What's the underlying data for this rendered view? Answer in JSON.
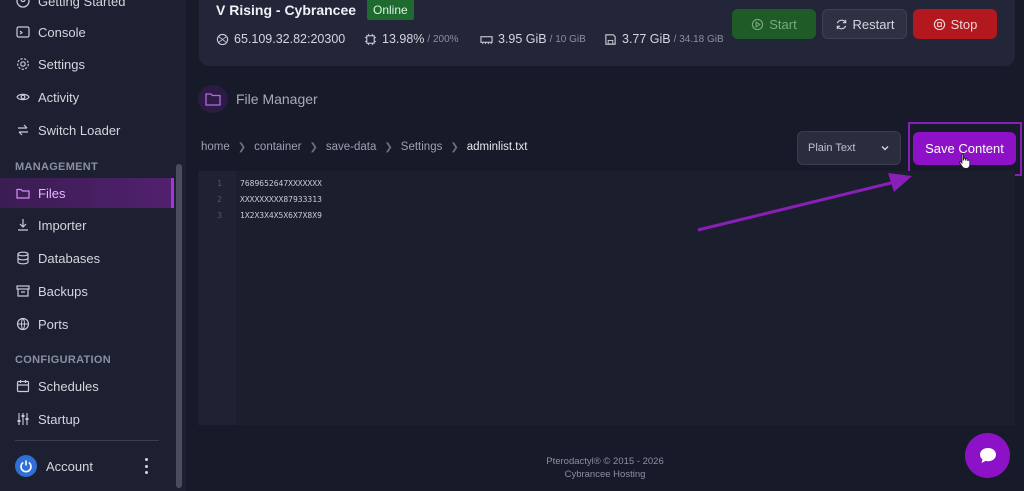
{
  "sidebar": {
    "items": [
      {
        "label": "Getting Started",
        "icon": "user-circle-icon"
      },
      {
        "label": "Console",
        "icon": "terminal-icon"
      },
      {
        "label": "Settings",
        "icon": "gear-icon"
      },
      {
        "label": "Activity",
        "icon": "eye-icon"
      },
      {
        "label": "Switch Loader",
        "icon": "swap-icon"
      }
    ],
    "management_heading": "MANAGEMENT",
    "management": [
      {
        "label": "Files",
        "icon": "folder-icon",
        "active": true
      },
      {
        "label": "Importer",
        "icon": "download-icon"
      },
      {
        "label": "Databases",
        "icon": "database-icon"
      },
      {
        "label": "Backups",
        "icon": "archive-icon"
      },
      {
        "label": "Ports",
        "icon": "globe-icon"
      }
    ],
    "configuration_heading": "CONFIGURATION",
    "configuration": [
      {
        "label": "Schedules",
        "icon": "calendar-icon"
      },
      {
        "label": "Startup",
        "icon": "sliders-icon"
      }
    ],
    "account_label": "Account"
  },
  "server": {
    "name": "V Rising - Cybrancee",
    "status": "Online",
    "address": "65.109.32.82:20300",
    "cpu": "13.98%",
    "cpu_limit": "/ 200%",
    "memory": "3.95 GiB",
    "memory_limit": "/ 10 GiB",
    "disk": "3.77 GiB",
    "disk_limit": "/ 34.18 GiB",
    "start_label": "Start",
    "restart_label": "Restart",
    "stop_label": "Stop"
  },
  "file_manager": {
    "title": "File Manager",
    "breadcrumb": [
      "home",
      "container",
      "save-data",
      "Settings",
      "adminlist.txt"
    ],
    "mode": "Plain Text",
    "save_label": "Save Content",
    "lines": [
      "7689652647XXXXXXX",
      "XXXXXXXXX87933313",
      "1X2X3X4X5X6X7X8X9"
    ]
  },
  "footer": {
    "line1": "Pterodactyl® © 2015 - 2026",
    "line2": "Cybrancee Hosting"
  },
  "colors": {
    "accent": "#8d12c7",
    "online": "#1f6a2f",
    "stop": "#b3181f",
    "start": "#1e5b26"
  }
}
